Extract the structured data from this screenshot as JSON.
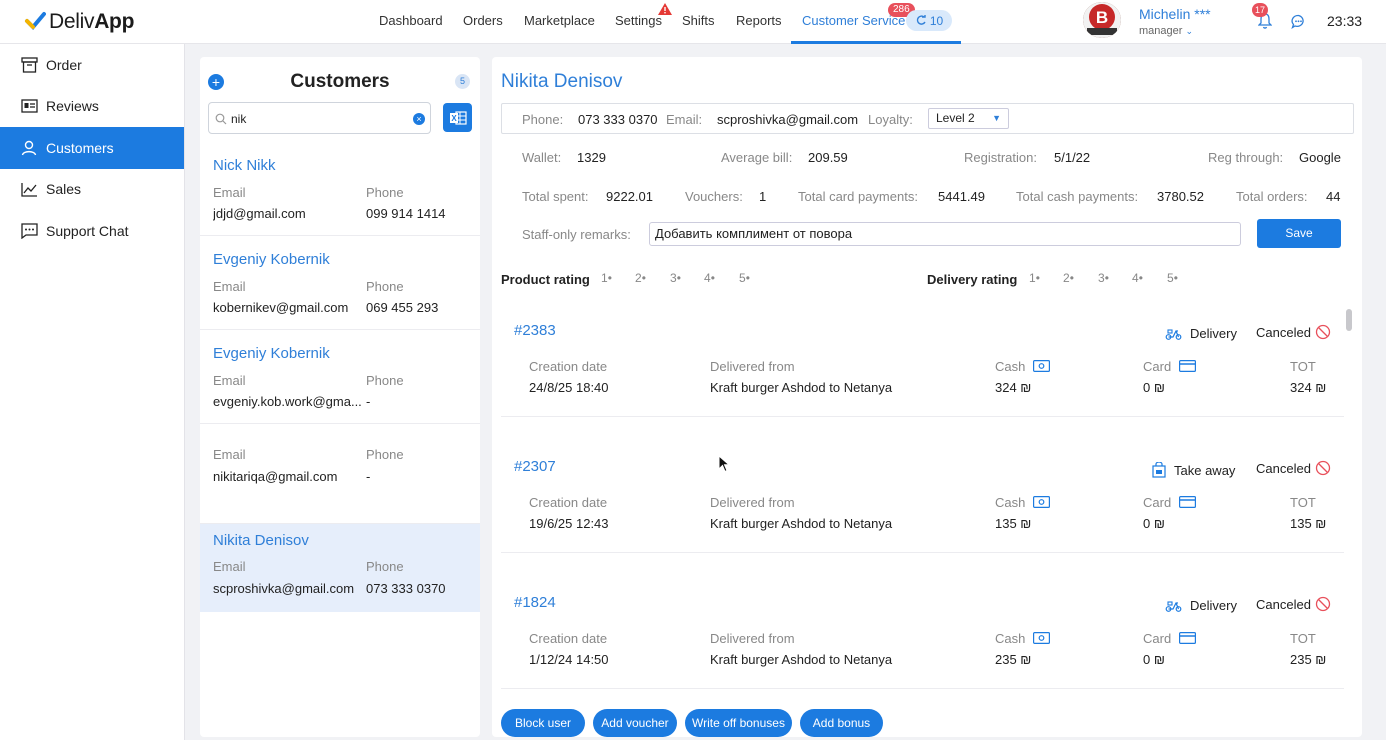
{
  "app": {
    "logo": "DelivApp",
    "logo_part1": "Deliv",
    "logo_part2": "App"
  },
  "nav": {
    "items": [
      "Dashboard",
      "Orders",
      "Marketplace",
      "Settings",
      "Shifts",
      "Reports",
      "Customer Service"
    ],
    "active": "Customer Service",
    "cs_badge": "286",
    "cs_pill": "10"
  },
  "user": {
    "name": "Michelin ***",
    "role": "manager",
    "notifications": "17",
    "time": "23:33"
  },
  "sidebar": {
    "items": [
      {
        "label": "Order",
        "icon": "order-icon"
      },
      {
        "label": "Reviews",
        "icon": "reviews-icon"
      },
      {
        "label": "Customers",
        "icon": "user-icon"
      },
      {
        "label": "Sales",
        "icon": "chart-icon"
      },
      {
        "label": "Support Chat",
        "icon": "chat-icon"
      }
    ],
    "active": "Customers"
  },
  "customers_panel": {
    "title": "Customers",
    "count": "5",
    "search_value": "nik",
    "email_label": "Email",
    "phone_label": "Phone",
    "list": [
      {
        "name": "Nick Nikk",
        "email": "jdjd@gmail.com",
        "phone": "099 914 1414"
      },
      {
        "name": "Evgeniy Kobernik",
        "email": "kobernikev@gmail.com",
        "phone": "069 455 293"
      },
      {
        "name": "Evgeniy Kobernik",
        "email": "evgeniy.kob.work@gma...",
        "phone": "-"
      },
      {
        "name": "",
        "email": "nikitariqa@gmail.com",
        "phone": "-"
      },
      {
        "name": "Nikita Denisov",
        "email": "scproshivka@gmail.com",
        "phone": "073 333 0370"
      }
    ]
  },
  "detail": {
    "name": "Nikita Denisov",
    "phone_label": "Phone:",
    "phone": "073 333 0370",
    "email_label": "Email:",
    "email": "scproshivka@gmail.com",
    "loyalty_label": "Loyalty:",
    "loyalty": "Level 2",
    "wallet_label": "Wallet:",
    "wallet": "1329",
    "avg_label": "Average bill:",
    "avg": "209.59",
    "reg_label": "Registration:",
    "reg": "5/1/22",
    "regthrough_label": "Reg through:",
    "regthrough": "Google",
    "spent_label": "Total spent:",
    "spent": "9222.01",
    "vouchers_label": "Vouchers:",
    "vouchers": "1",
    "card_label": "Total card payments:",
    "card": "5441.49",
    "cash_label": "Total cash payments:",
    "cash": "3780.52",
    "orders_label": "Total orders:",
    "orders": "44",
    "remarks_label": "Staff-only remarks:",
    "remarks": "Добавить комплимент от повора",
    "save": "Save",
    "product_rating": "Product rating",
    "delivery_rating": "Delivery rating",
    "stars": [
      "1",
      "2",
      "3",
      "4",
      "5"
    ]
  },
  "order_labels": {
    "creation": "Creation date",
    "from": "Delivered from",
    "cash": "Cash",
    "card": "Card",
    "tot": "TOT"
  },
  "orders": [
    {
      "num": "#2383",
      "type": "Delivery",
      "status": "Canceled",
      "date": "24/8/25 18:40",
      "from": "Kraft burger Ashdod to Netanya",
      "cash": "324 ₪",
      "card": "0 ₪",
      "tot": "324 ₪"
    },
    {
      "num": "#2307",
      "type": "Take away",
      "status": "Canceled",
      "date": "19/6/25 12:43",
      "from": "Kraft burger Ashdod to Netanya",
      "cash": "135 ₪",
      "card": "0 ₪",
      "tot": "135 ₪"
    },
    {
      "num": "#1824",
      "type": "Delivery",
      "status": "Canceled",
      "date": "1/12/24 14:50",
      "from": "Kraft burger Ashdod to Netanya",
      "cash": "235 ₪",
      "card": "0 ₪",
      "tot": "235 ₪"
    }
  ],
  "actions": [
    "Block user",
    "Add voucher",
    "Write off bonuses",
    "Add bonus"
  ],
  "colors": {
    "accent": "#1c7be0",
    "link": "#2f7fd8",
    "danger": "#e8505b",
    "selected_row": "#e6eefb"
  }
}
